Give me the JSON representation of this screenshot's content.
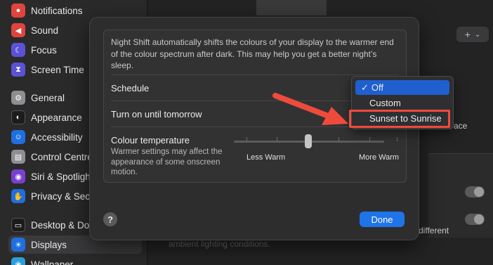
{
  "sidebar": {
    "items": [
      {
        "label": "Notifications",
        "icon": "bell-icon",
        "color": "#e0443e"
      },
      {
        "label": "Sound",
        "icon": "speaker-icon",
        "color": "#e0443e"
      },
      {
        "label": "Focus",
        "icon": "moon-icon",
        "color": "#5b52d6"
      },
      {
        "label": "Screen Time",
        "icon": "hourglass-icon",
        "color": "#5b52d6"
      },
      {
        "label": "General",
        "icon": "gear-icon",
        "color": "#8e8e93"
      },
      {
        "label": "Appearance",
        "icon": "appearance-icon",
        "color": "#1c1c1e"
      },
      {
        "label": "Accessibility",
        "icon": "accessibility-icon",
        "color": "#1f6fe0"
      },
      {
        "label": "Control Centre",
        "icon": "control-centre-icon",
        "color": "#8e8e93"
      },
      {
        "label": "Siri & Spotlight",
        "icon": "siri-icon",
        "color": "#7a3fd0"
      },
      {
        "label": "Privacy & Security",
        "icon": "hand-icon",
        "color": "#1f6fe0"
      },
      {
        "label": "Desktop & Dock",
        "icon": "desktop-icon",
        "color": "#1c1c1e"
      },
      {
        "label": "Displays",
        "icon": "display-icon",
        "color": "#1f6fe0"
      },
      {
        "label": "Wallpaper",
        "icon": "wallpaper-icon",
        "color": "#2aa0d8"
      }
    ]
  },
  "background": {
    "add_button": "+",
    "space_text": "ace",
    "different_text": "different",
    "ambient_text": "ambient lighting conditions."
  },
  "modal": {
    "description": "Night Shift automatically shifts the colours of your display to the warmer end of the colour spectrum after dark. This may help you get a better night’s sleep.",
    "schedule_label": "Schedule",
    "turn_on_label": "Turn on until tomorrow",
    "temperature_label": "Colour temperature",
    "temperature_note": "Warmer settings may affect the appearance of some onscreen motion.",
    "slider_min_label": "Less Warm",
    "slider_max_label": "More Warm",
    "slider_value": 0.5,
    "help_label": "?",
    "done_label": "Done"
  },
  "dropdown": {
    "options": [
      {
        "label": "Off",
        "checked": true
      },
      {
        "label": "Custom",
        "checked": false
      },
      {
        "label": "Sunset to Sunrise",
        "checked": false
      }
    ],
    "check_mark": "✓"
  },
  "colors": {
    "accent": "#1f74e8",
    "annotation": "#ef4b3c"
  }
}
